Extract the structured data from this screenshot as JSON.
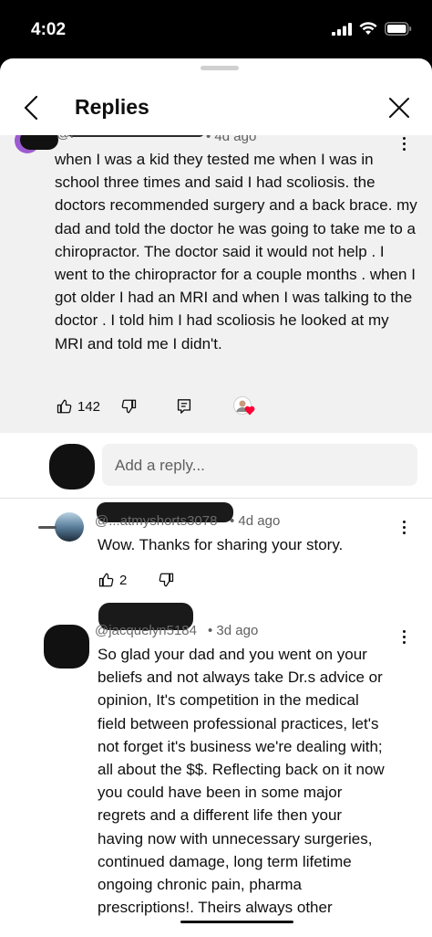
{
  "status_bar": {
    "time": "4:02"
  },
  "header": {
    "title": "Replies"
  },
  "parent_comment": {
    "author": "@l",
    "timestamp": "4d ago",
    "text": "when I was a kid they tested me when I was in school three times and said I had scoliosis. the doctors recommended surgery and a back brace. my dad and told the doctor he was going to take me to a chiropractor.  The doctor said it would not help . I went to the chiropractor for a couple months . when I got older I had an MRI and when I was talking to the doctor . I told him I had scoliosis he looked at my  MRI and told me I didn't.",
    "likes": "142",
    "accent_color": "#9c5bd1",
    "heart_color": "#ff0033"
  },
  "reply_input": {
    "placeholder": "Add a reply..."
  },
  "replies": [
    {
      "author": "@...atmyshorts3078",
      "timestamp": "4d ago",
      "text": "Wow. Thanks for sharing your story.",
      "likes": "2"
    },
    {
      "author": "@jacquelyn5184",
      "timestamp": "3d ago",
      "text": "So glad your dad and you went on your beliefs and not always take Dr.s advice or opinion, It's competition in the medical field between professional practices, let's not forget it's business we're dealing with; all about the $$. Reflecting back on it now you could have been in some major regrets and a different life then your having now with unnecessary surgeries, continued damage, long term lifetime ongoing chronic pain, pharma prescriptions!. Theirs always other"
    }
  ]
}
